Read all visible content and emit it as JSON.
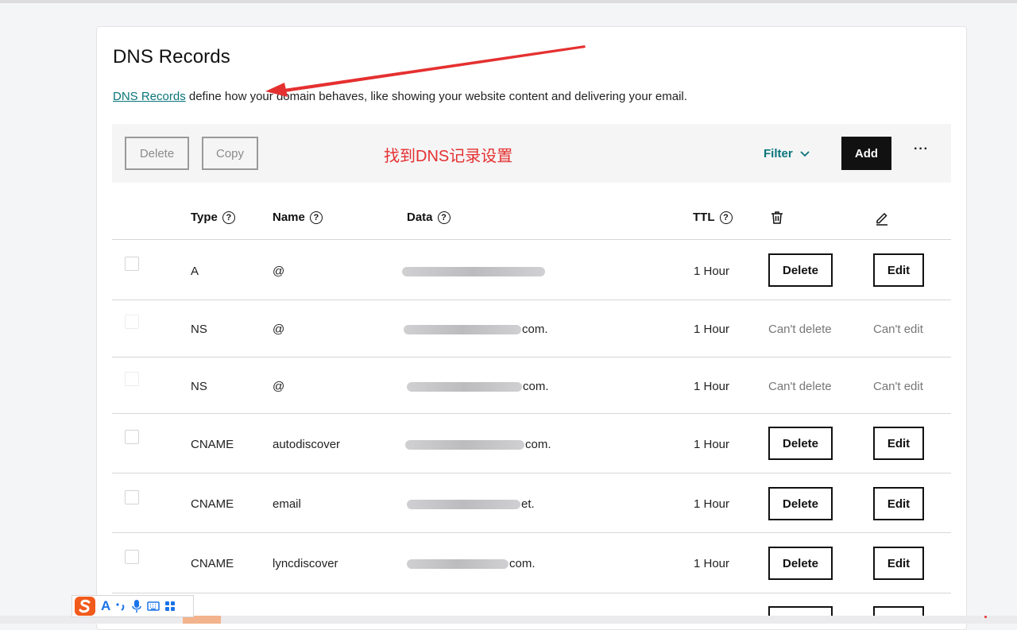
{
  "header": {
    "title": "DNS Records",
    "desc_link": "DNS Records",
    "desc_rest": " define how your domain behaves, like showing your website content and delivering your email."
  },
  "toolbar": {
    "delete_label": "Delete",
    "copy_label": "Copy",
    "filter_label": "Filter",
    "add_label": "Add",
    "more_label": "···"
  },
  "annotation": {
    "text": "找到DNS记录设置",
    "color": "#e53030"
  },
  "table": {
    "columns": {
      "type": "Type",
      "name": "Name",
      "data": "Data",
      "ttl": "TTL"
    },
    "rows": [
      {
        "type": "A",
        "name": "@",
        "data_suffix": "",
        "ttl": "1 Hour",
        "delete": "Delete",
        "edit": "Edit"
      },
      {
        "type": "NS",
        "name": "@",
        "data_suffix": "com.",
        "ttl": "1 Hour",
        "delete": "Can't delete",
        "edit": "Can't edit"
      },
      {
        "type": "NS",
        "name": "@",
        "data_suffix": "com.",
        "ttl": "1 Hour",
        "delete": "Can't delete",
        "edit": "Can't edit"
      },
      {
        "type": "CNAME",
        "name": "autodiscover",
        "data_suffix": "com.",
        "ttl": "1 Hour",
        "delete": "Delete",
        "edit": "Edit"
      },
      {
        "type": "CNAME",
        "name": "email",
        "data_suffix": "et.",
        "ttl": "1 Hour",
        "delete": "Delete",
        "edit": "Edit"
      },
      {
        "type": "CNAME",
        "name": "lyncdiscover",
        "data_suffix": "com.",
        "ttl": "1 Hour",
        "delete": "Delete",
        "edit": "Edit"
      }
    ]
  },
  "ime": {
    "mode": "A"
  },
  "colors": {
    "accent": "#09757a",
    "primary_button": "#111111",
    "annotation": "#e53030"
  }
}
